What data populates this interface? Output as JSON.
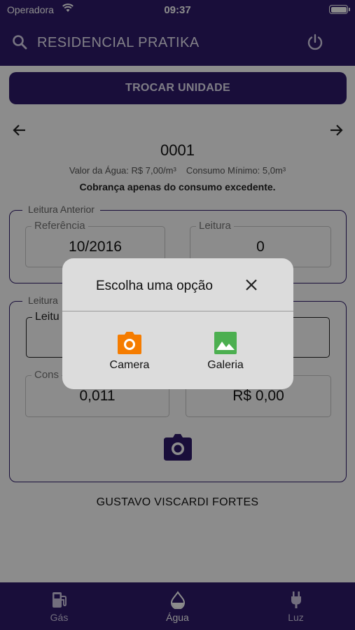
{
  "status_bar": {
    "carrier": "Operadora",
    "time": "09:37"
  },
  "header": {
    "title": "RESIDENCIAL PRATIKA",
    "search_icon": "search-icon",
    "power_icon": "power-icon"
  },
  "actions": {
    "trocar_label": "TROCAR UNIDADE"
  },
  "unit": {
    "number": "0001",
    "valor_agua": "Valor da Água: R$ 7,00/m³",
    "consumo_minimo": "Consumo Mínimo: 5,0m³",
    "cobranca": "Cobrança apenas do consumo excedente."
  },
  "leitura_anterior": {
    "legend": "Leitura Anterior",
    "referencia_label": "Referência",
    "referencia_value": "10/2016",
    "leitura_label": "Leitura",
    "leitura_value": "0"
  },
  "leitura_atual": {
    "legend": "Leitura",
    "leitura_label": "Leitu",
    "consumo_label": "Cons",
    "consumo_value": "0,011",
    "valor_value": "R$ 0,00"
  },
  "owner": "GUSTAVO VISCARDI FORTES",
  "tabs": [
    {
      "label": "Gás",
      "icon": "gas-pump-icon"
    },
    {
      "label": "Água",
      "icon": "water-drop-icon",
      "active": true
    },
    {
      "label": "Luz",
      "icon": "plug-icon"
    }
  ],
  "dialog": {
    "title": "Escolha uma opção",
    "options": [
      {
        "label": "Camera",
        "icon": "camera-icon",
        "color": "#f57c00"
      },
      {
        "label": "Galeria",
        "icon": "image-icon",
        "color": "#4caf50"
      }
    ]
  },
  "colors": {
    "primary": "#2e1b6b",
    "overlay": "rgba(0,0,0,0.45)"
  }
}
